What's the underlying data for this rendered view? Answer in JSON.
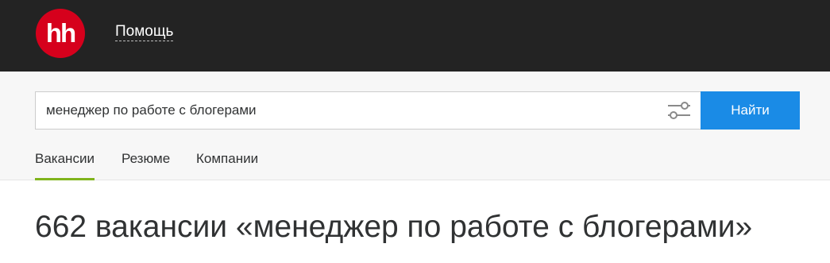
{
  "header": {
    "logo_text": "hh",
    "help_label": "Помощь",
    "logo_color": "#d6001c",
    "background_color": "#232323"
  },
  "search": {
    "query": "менеджер по работе с блогерами",
    "filter_icon": "sliders-icon",
    "button_label": "Найти",
    "button_color": "#1a8be6"
  },
  "tabs": [
    {
      "label": "Вакансии",
      "active": true
    },
    {
      "label": "Резюме",
      "active": false
    },
    {
      "label": "Компании",
      "active": false
    }
  ],
  "tab_active_color": "#80b41c",
  "results": {
    "title": "662 вакансии «менеджер по работе с блогерами»"
  }
}
